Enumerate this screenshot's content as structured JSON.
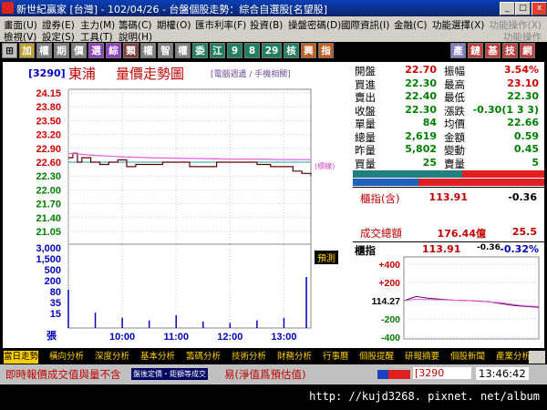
{
  "window": {
    "title": "新世紀贏家 [台灣] - 102/04/26 - 台盤個股走勢：綜合自選股[名望股]",
    "buttons": [
      "_",
      "□",
      "x"
    ]
  },
  "menu": {
    "row1": [
      "畫面(U)",
      "證券(E)",
      "主力(M)",
      "籌碼(C)",
      "期權(O)",
      "匯市利率(F)",
      "投資(B)",
      "操盤密碼(D)",
      "國際資訊(I)",
      "金融(C)",
      "功能選擇(X)"
    ],
    "row1_right": "功能操作(X)",
    "row2": [
      "檢視(V)",
      "設定(S)",
      "工具(T)",
      "說明(H)"
    ],
    "row2_right": "功能操作"
  },
  "toolbar": {
    "left_buttons": [
      "⊞",
      "加",
      "權",
      "期",
      "價",
      "選",
      "綜",
      "類",
      "權",
      "智",
      "權",
      "委",
      "江",
      "9",
      "8",
      "29",
      "核",
      "興",
      "指"
    ],
    "right_buttons": [
      "產",
      "鏈",
      "基",
      "技",
      "網"
    ]
  },
  "chart": {
    "stock_code": "[3290]",
    "stock_name": "東浦",
    "chart_name": "量價走勢圖",
    "sub_label": "[電腦週邊 / 手機相關]",
    "limit_label": "(標線)",
    "forecast_button": "預測",
    "unit_label": "張",
    "price_ticks": [
      "24.15",
      "23.80",
      "23.50",
      "23.20",
      "22.90",
      "22.60",
      "22.30",
      "22.00",
      "21.70",
      "21.40",
      "21.05"
    ],
    "volume_ticks": [
      "3,000",
      "1,500",
      "500",
      "200",
      "80",
      "35",
      "15"
    ],
    "time_ticks": [
      "09:00",
      "10:00",
      "11:00",
      "12:00",
      "13:00"
    ]
  },
  "chart_data": {
    "type": "line",
    "title": "量價走勢圖",
    "xlabel": "",
    "ylabel": "",
    "x_range": [
      "09:00",
      "13:30"
    ],
    "ylim": [
      21.05,
      24.15
    ],
    "reference_price": 22.6,
    "series": [
      {
        "x": [
          "09:00",
          "09:05",
          "09:10",
          "09:15",
          "09:25",
          "09:35",
          "09:45",
          "09:55",
          "10:05",
          "10:15",
          "10:30",
          "10:45",
          "11:00",
          "11:15",
          "11:30",
          "11:45",
          "12:00",
          "12:15",
          "12:30",
          "12:45",
          "13:00",
          "13:10",
          "13:20",
          "13:30"
        ],
        "values": [
          22.7,
          22.8,
          22.6,
          22.7,
          22.6,
          22.55,
          22.6,
          22.65,
          22.5,
          22.55,
          22.55,
          22.6,
          22.6,
          22.5,
          22.5,
          22.6,
          22.6,
          22.6,
          22.55,
          22.5,
          22.5,
          22.4,
          22.35,
          22.3
        ]
      },
      {
        "x": [
          "09:00",
          "09:30",
          "10:00",
          "10:30",
          "11:00",
          "11:30",
          "12:00",
          "12:30",
          "13:00",
          "13:30"
        ],
        "values": [
          22.8,
          22.75,
          22.72,
          22.7,
          22.69,
          22.68,
          22.67,
          22.67,
          22.66,
          22.66
        ]
      }
    ],
    "volume": {
      "x": [
        "09:00",
        "09:30",
        "10:00",
        "10:30",
        "11:00",
        "11:30",
        "12:00",
        "12:30",
        "13:00",
        "13:25"
      ],
      "values": [
        30,
        12,
        8,
        6,
        10,
        5,
        4,
        6,
        8,
        40
      ]
    }
  },
  "quote": {
    "rows": [
      {
        "l": "開盤",
        "lv": "22.70",
        "lc": "up",
        "r": "振幅",
        "rv": "3.54%",
        "rc": "up"
      },
      {
        "l": "買進",
        "lv": "22.30",
        "lc": "dn",
        "r": "最高",
        "rv": "23.10",
        "rc": "up"
      },
      {
        "l": "賣出",
        "lv": "22.40",
        "lc": "dn",
        "r": "最低",
        "rv": "22.30",
        "rc": "dn"
      },
      {
        "l": "收盤",
        "lv": "22.30",
        "lc": "dn",
        "r": "漲跌",
        "rv": "-0.30(1 3 3)",
        "rc": "dn"
      },
      {
        "l": "單量",
        "lv": "84",
        "lc": "dn",
        "r": "均價",
        "rv": "22.66",
        "rc": "dn"
      },
      {
        "l": "總量",
        "lv": "2,619",
        "lc": "dn",
        "r": "金額",
        "rv": "0.59",
        "rc": "dn"
      },
      {
        "l": "昨量",
        "lv": "5,802",
        "lc": "dn",
        "r": "變動",
        "rv": "0.45",
        "rc": "dn"
      },
      {
        "l": "買量",
        "lv": "25",
        "lc": "dn",
        "r": "賣量",
        "rv": "5",
        "rc": "dn"
      }
    ],
    "index_label": "櫃指(含)",
    "index_value": "113.91",
    "index_change": "-0.36",
    "turnover_label": "成交總額",
    "turnover_value": "176.44億",
    "turnover_change": "25.5"
  },
  "mini_chart": {
    "title": "櫃指",
    "value": "113.91",
    "change": "-0.36",
    "pct": "-0.32%",
    "ticks": [
      "+400",
      "+200",
      "114.27",
      "-200",
      "-400"
    ]
  },
  "chart_data_mini": {
    "type": "line",
    "series": [
      {
        "values": [
          114.27,
          114.5,
          114.4,
          114.35,
          114.3,
          114.28,
          114.25,
          114.2,
          114.1,
          114.0,
          113.95,
          113.91
        ]
      },
      {
        "values": [
          114.27,
          114.35,
          114.33,
          114.32,
          114.3,
          114.28,
          114.24,
          114.2,
          114.15,
          114.05,
          113.98,
          113.95
        ]
      }
    ]
  },
  "tabs": [
    "當日走勢",
    "橫向分析",
    "深度分析",
    "基本分析",
    "籌碼分析",
    "技術分析",
    "財務分析",
    "行事曆",
    "個股提醒",
    "研報摘要",
    "個股新聞",
    "產業分析"
  ],
  "status": {
    "message": "即時報價成交值與量不含",
    "overlay": "盤後定價・鉅額等成交",
    "message_tail": "易(淨值爲預估值)",
    "code": "[3290",
    "time": "13:46:42"
  },
  "url": "http: //kujd3268. pixnet. net/album"
}
